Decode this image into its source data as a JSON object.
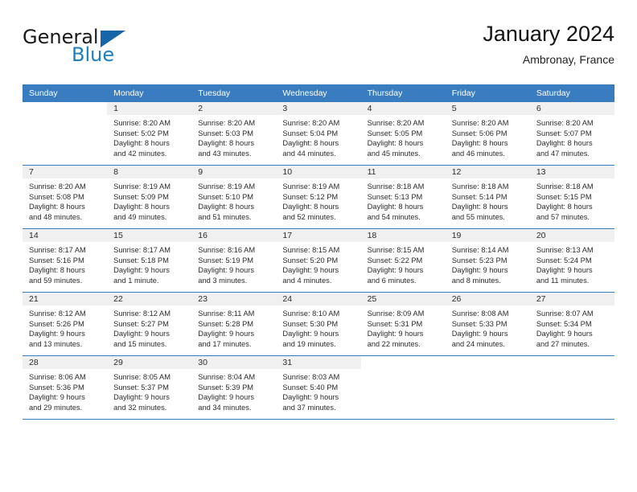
{
  "brand": {
    "name_part1": "General",
    "name_part2": "Blue",
    "triangle_color": "#1565a8",
    "blue_color": "#1c7fc4"
  },
  "header": {
    "title": "January 2024",
    "location": "Ambronay, France"
  },
  "theme": {
    "header_row_bg": "#3a7cc0",
    "daynum_strip_bg": "#f0f0f0",
    "grid_line": "#3a7cc0",
    "text": "#2b2b2b"
  },
  "weekday_headers": [
    "Sunday",
    "Monday",
    "Tuesday",
    "Wednesday",
    "Thursday",
    "Friday",
    "Saturday"
  ],
  "weeks": [
    [
      {
        "day": "",
        "lines": []
      },
      {
        "day": "1",
        "lines": [
          "Sunrise: 8:20 AM",
          "Sunset: 5:02 PM",
          "Daylight: 8 hours",
          "and 42 minutes."
        ]
      },
      {
        "day": "2",
        "lines": [
          "Sunrise: 8:20 AM",
          "Sunset: 5:03 PM",
          "Daylight: 8 hours",
          "and 43 minutes."
        ]
      },
      {
        "day": "3",
        "lines": [
          "Sunrise: 8:20 AM",
          "Sunset: 5:04 PM",
          "Daylight: 8 hours",
          "and 44 minutes."
        ]
      },
      {
        "day": "4",
        "lines": [
          "Sunrise: 8:20 AM",
          "Sunset: 5:05 PM",
          "Daylight: 8 hours",
          "and 45 minutes."
        ]
      },
      {
        "day": "5",
        "lines": [
          "Sunrise: 8:20 AM",
          "Sunset: 5:06 PM",
          "Daylight: 8 hours",
          "and 46 minutes."
        ]
      },
      {
        "day": "6",
        "lines": [
          "Sunrise: 8:20 AM",
          "Sunset: 5:07 PM",
          "Daylight: 8 hours",
          "and 47 minutes."
        ]
      }
    ],
    [
      {
        "day": "7",
        "lines": [
          "Sunrise: 8:20 AM",
          "Sunset: 5:08 PM",
          "Daylight: 8 hours",
          "and 48 minutes."
        ]
      },
      {
        "day": "8",
        "lines": [
          "Sunrise: 8:19 AM",
          "Sunset: 5:09 PM",
          "Daylight: 8 hours",
          "and 49 minutes."
        ]
      },
      {
        "day": "9",
        "lines": [
          "Sunrise: 8:19 AM",
          "Sunset: 5:10 PM",
          "Daylight: 8 hours",
          "and 51 minutes."
        ]
      },
      {
        "day": "10",
        "lines": [
          "Sunrise: 8:19 AM",
          "Sunset: 5:12 PM",
          "Daylight: 8 hours",
          "and 52 minutes."
        ]
      },
      {
        "day": "11",
        "lines": [
          "Sunrise: 8:18 AM",
          "Sunset: 5:13 PM",
          "Daylight: 8 hours",
          "and 54 minutes."
        ]
      },
      {
        "day": "12",
        "lines": [
          "Sunrise: 8:18 AM",
          "Sunset: 5:14 PM",
          "Daylight: 8 hours",
          "and 55 minutes."
        ]
      },
      {
        "day": "13",
        "lines": [
          "Sunrise: 8:18 AM",
          "Sunset: 5:15 PM",
          "Daylight: 8 hours",
          "and 57 minutes."
        ]
      }
    ],
    [
      {
        "day": "14",
        "lines": [
          "Sunrise: 8:17 AM",
          "Sunset: 5:16 PM",
          "Daylight: 8 hours",
          "and 59 minutes."
        ]
      },
      {
        "day": "15",
        "lines": [
          "Sunrise: 8:17 AM",
          "Sunset: 5:18 PM",
          "Daylight: 9 hours",
          "and 1 minute."
        ]
      },
      {
        "day": "16",
        "lines": [
          "Sunrise: 8:16 AM",
          "Sunset: 5:19 PM",
          "Daylight: 9 hours",
          "and 3 minutes."
        ]
      },
      {
        "day": "17",
        "lines": [
          "Sunrise: 8:15 AM",
          "Sunset: 5:20 PM",
          "Daylight: 9 hours",
          "and 4 minutes."
        ]
      },
      {
        "day": "18",
        "lines": [
          "Sunrise: 8:15 AM",
          "Sunset: 5:22 PM",
          "Daylight: 9 hours",
          "and 6 minutes."
        ]
      },
      {
        "day": "19",
        "lines": [
          "Sunrise: 8:14 AM",
          "Sunset: 5:23 PM",
          "Daylight: 9 hours",
          "and 8 minutes."
        ]
      },
      {
        "day": "20",
        "lines": [
          "Sunrise: 8:13 AM",
          "Sunset: 5:24 PM",
          "Daylight: 9 hours",
          "and 11 minutes."
        ]
      }
    ],
    [
      {
        "day": "21",
        "lines": [
          "Sunrise: 8:12 AM",
          "Sunset: 5:26 PM",
          "Daylight: 9 hours",
          "and 13 minutes."
        ]
      },
      {
        "day": "22",
        "lines": [
          "Sunrise: 8:12 AM",
          "Sunset: 5:27 PM",
          "Daylight: 9 hours",
          "and 15 minutes."
        ]
      },
      {
        "day": "23",
        "lines": [
          "Sunrise: 8:11 AM",
          "Sunset: 5:28 PM",
          "Daylight: 9 hours",
          "and 17 minutes."
        ]
      },
      {
        "day": "24",
        "lines": [
          "Sunrise: 8:10 AM",
          "Sunset: 5:30 PM",
          "Daylight: 9 hours",
          "and 19 minutes."
        ]
      },
      {
        "day": "25",
        "lines": [
          "Sunrise: 8:09 AM",
          "Sunset: 5:31 PM",
          "Daylight: 9 hours",
          "and 22 minutes."
        ]
      },
      {
        "day": "26",
        "lines": [
          "Sunrise: 8:08 AM",
          "Sunset: 5:33 PM",
          "Daylight: 9 hours",
          "and 24 minutes."
        ]
      },
      {
        "day": "27",
        "lines": [
          "Sunrise: 8:07 AM",
          "Sunset: 5:34 PM",
          "Daylight: 9 hours",
          "and 27 minutes."
        ]
      }
    ],
    [
      {
        "day": "28",
        "lines": [
          "Sunrise: 8:06 AM",
          "Sunset: 5:36 PM",
          "Daylight: 9 hours",
          "and 29 minutes."
        ]
      },
      {
        "day": "29",
        "lines": [
          "Sunrise: 8:05 AM",
          "Sunset: 5:37 PM",
          "Daylight: 9 hours",
          "and 32 minutes."
        ]
      },
      {
        "day": "30",
        "lines": [
          "Sunrise: 8:04 AM",
          "Sunset: 5:39 PM",
          "Daylight: 9 hours",
          "and 34 minutes."
        ]
      },
      {
        "day": "31",
        "lines": [
          "Sunrise: 8:03 AM",
          "Sunset: 5:40 PM",
          "Daylight: 9 hours",
          "and 37 minutes."
        ]
      },
      {
        "day": "",
        "lines": []
      },
      {
        "day": "",
        "lines": []
      },
      {
        "day": "",
        "lines": []
      }
    ]
  ]
}
